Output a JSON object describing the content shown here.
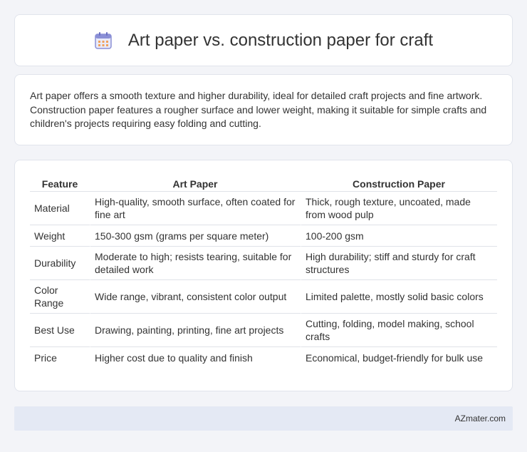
{
  "header": {
    "title": "Art paper vs. construction paper for craft",
    "icon": "calendar-icon",
    "icon_color": "#8a8fd6"
  },
  "summary": {
    "text": "Art paper offers a smooth texture and higher durability, ideal for detailed craft projects and fine artwork. Construction paper features a rougher surface and lower weight, making it suitable for simple crafts and children's projects requiring easy folding and cutting."
  },
  "table": {
    "headers": [
      "Feature",
      "Art Paper",
      "Construction Paper"
    ],
    "rows": [
      {
        "feature": "Material",
        "art": "High-quality, smooth surface, often coated for fine art",
        "construction": "Thick, rough texture, uncoated, made from wood pulp"
      },
      {
        "feature": "Weight",
        "art": "150-300 gsm (grams per square meter)",
        "construction": "100-200 gsm"
      },
      {
        "feature": "Durability",
        "art": "Moderate to high; resists tearing, suitable for detailed work",
        "construction": "High durability; stiff and sturdy for craft structures"
      },
      {
        "feature": "Color Range",
        "art": "Wide range, vibrant, consistent color output",
        "construction": "Limited palette, mostly solid basic colors"
      },
      {
        "feature": "Best Use",
        "art": "Drawing, painting, printing, fine art projects",
        "construction": "Cutting, folding, model making, school crafts"
      },
      {
        "feature": "Price",
        "art": "Higher cost due to quality and finish",
        "construction": "Economical, budget-friendly for bulk use"
      }
    ]
  },
  "footer": {
    "brand": "AZmater.com"
  }
}
